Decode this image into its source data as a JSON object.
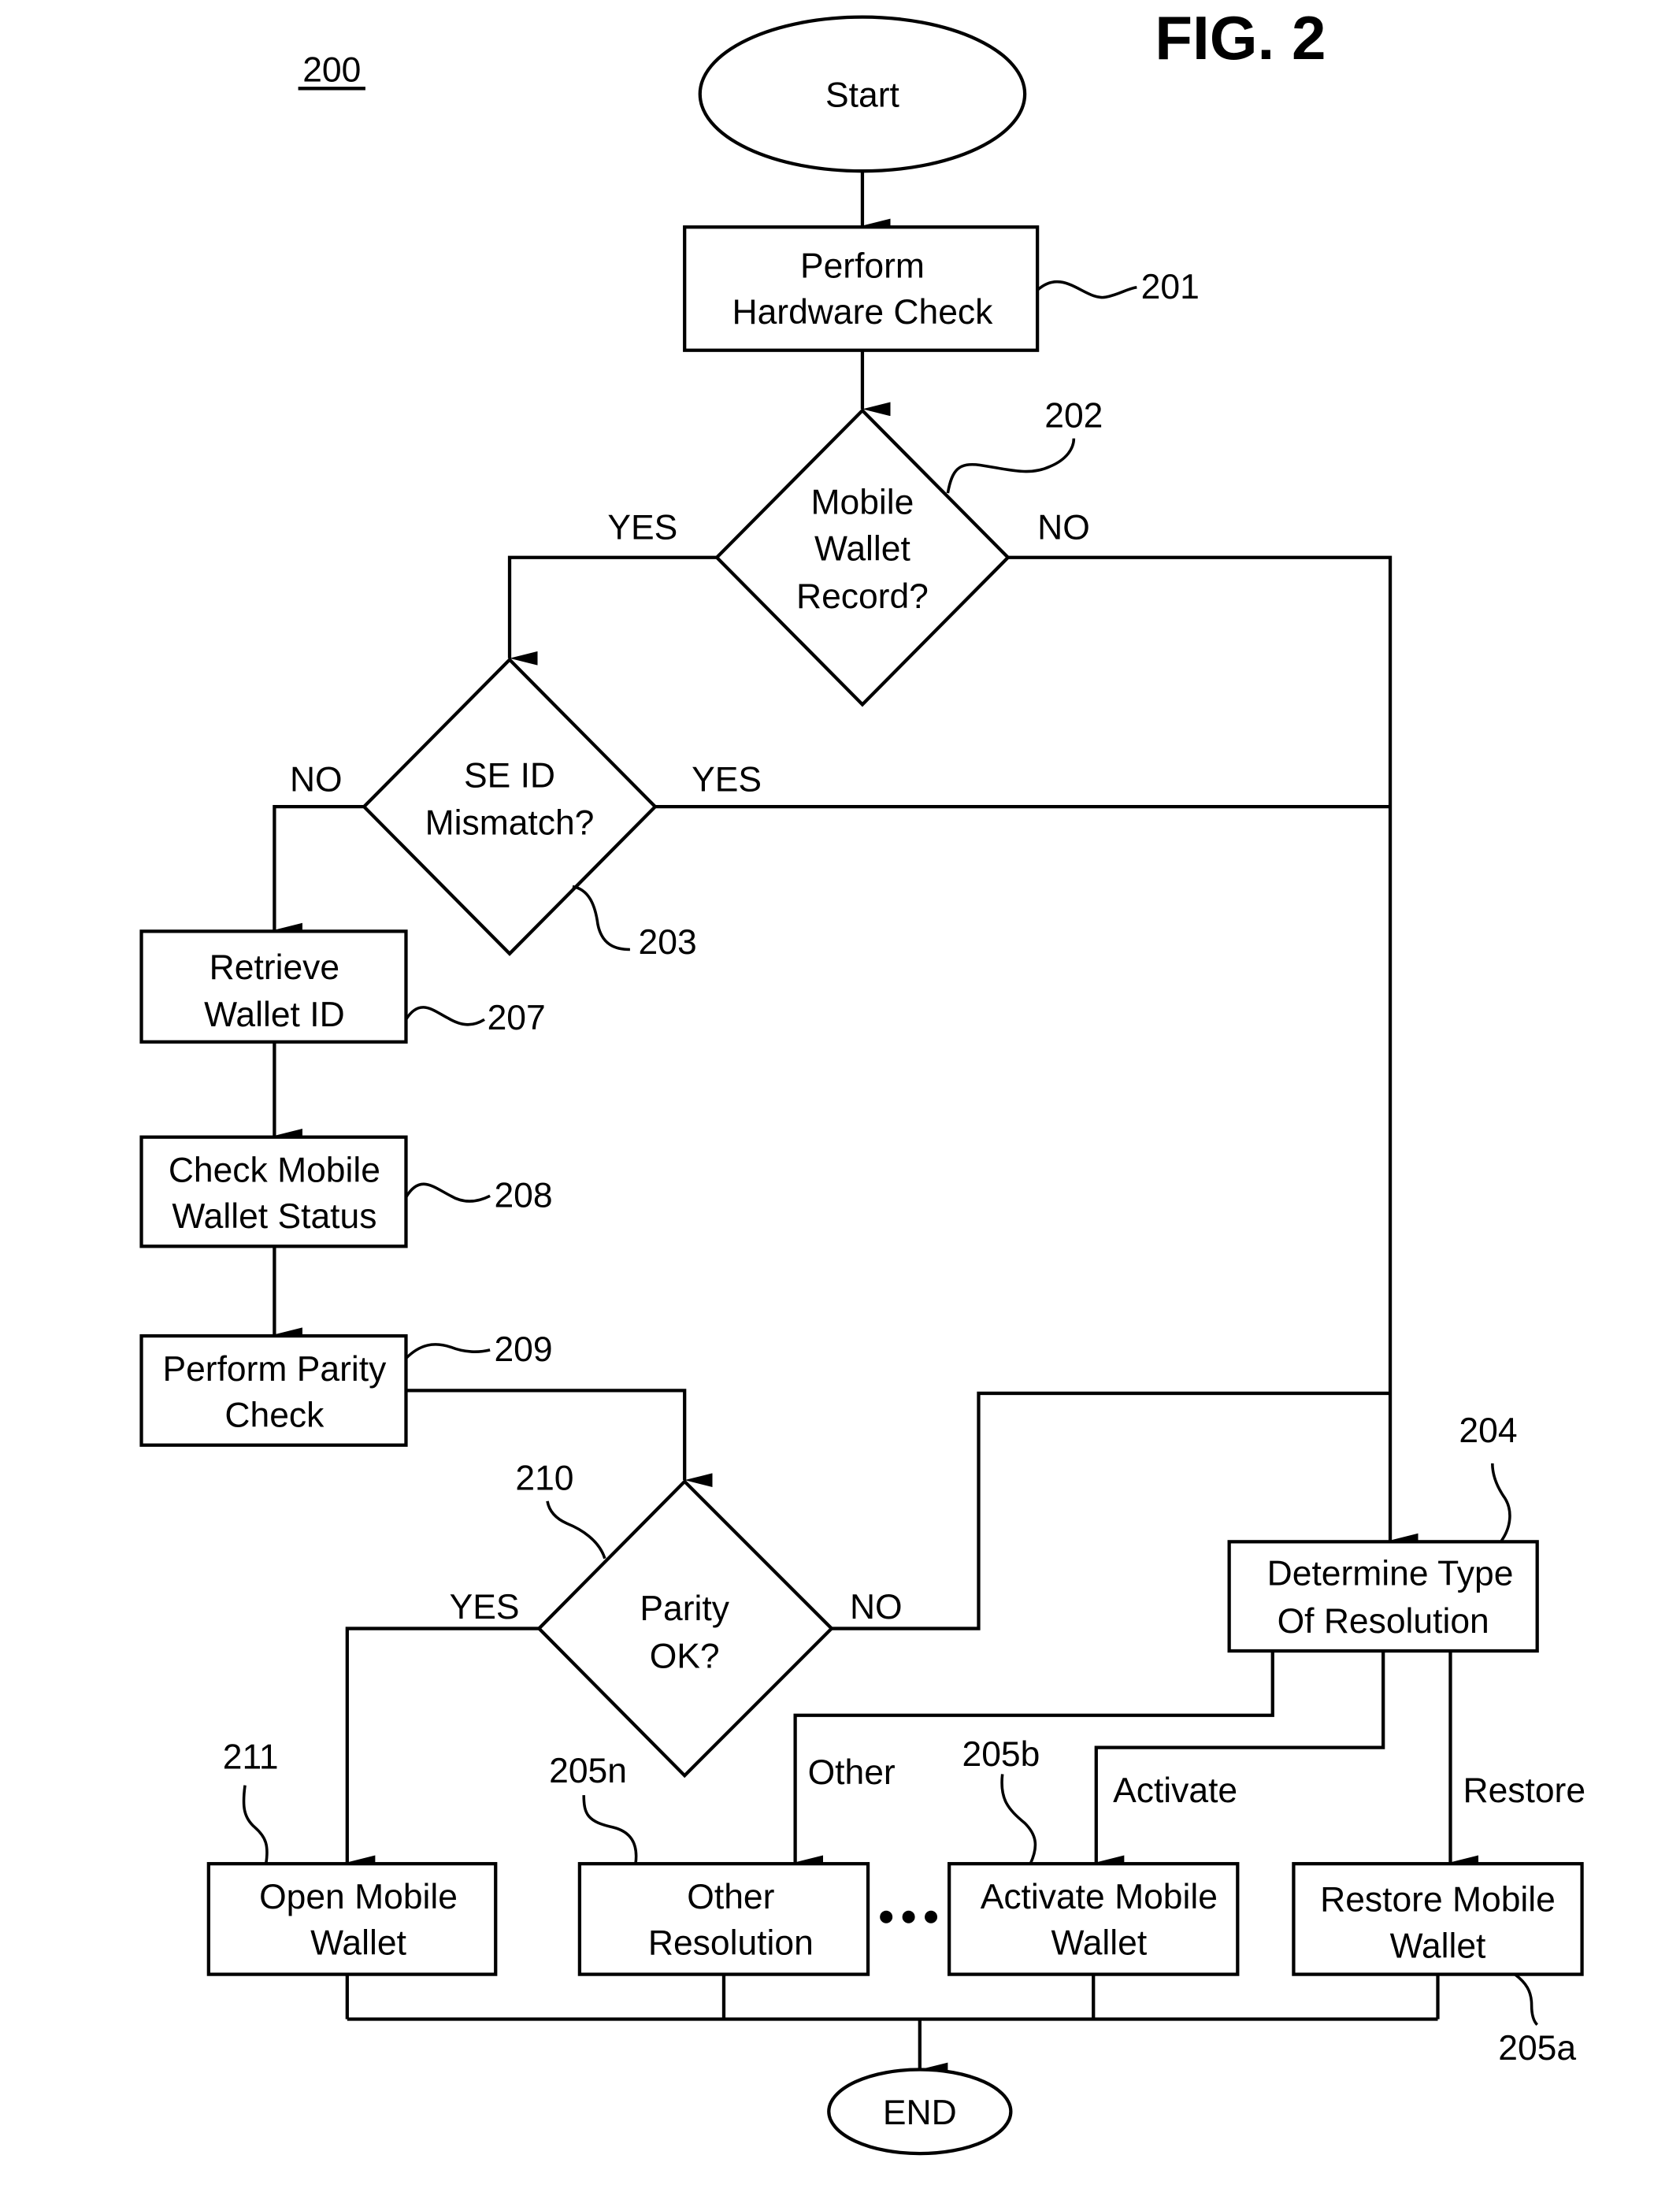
{
  "figure": {
    "title": "FIG. 2",
    "ref_number": "200"
  },
  "nodes": {
    "start": {
      "label": "Start"
    },
    "n201": {
      "lines": [
        "Perform",
        "Hardware Check"
      ],
      "ref": "201"
    },
    "n202": {
      "lines": [
        "Mobile",
        "Wallet",
        "Record?"
      ],
      "ref": "202"
    },
    "n203": {
      "lines": [
        "SE ID",
        "Mismatch?"
      ],
      "ref": "203"
    },
    "n204": {
      "lines": [
        "Determine Type",
        "Of Resolution"
      ],
      "ref": "204"
    },
    "n205a": {
      "lines": [
        "Restore Mobile",
        "Wallet"
      ],
      "ref": "205a"
    },
    "n205b": {
      "lines": [
        "Activate Mobile",
        "Wallet"
      ],
      "ref": "205b"
    },
    "n205n": {
      "lines": [
        "Other",
        "Resolution"
      ],
      "ref": "205n"
    },
    "n207": {
      "lines": [
        "Retrieve",
        "Wallet ID"
      ],
      "ref": "207"
    },
    "n208": {
      "lines": [
        "Check Mobile",
        "Wallet Status"
      ],
      "ref": "208"
    },
    "n209": {
      "lines": [
        "Perform Parity",
        "Check"
      ],
      "ref": "209"
    },
    "n210": {
      "lines": [
        "Parity",
        "OK?"
      ],
      "ref": "210"
    },
    "n211": {
      "lines": [
        "Open Mobile",
        "Wallet"
      ],
      "ref": "211"
    },
    "end": {
      "label": "END"
    }
  },
  "edge_labels": {
    "n202_yes": "YES",
    "n202_no": "NO",
    "n203_no": "NO",
    "n203_yes": "YES",
    "n210_yes": "YES",
    "n210_no": "NO",
    "other": "Other",
    "activate": "Activate",
    "restore": "Restore"
  },
  "ellipsis_icon": "ellipsis-dots"
}
